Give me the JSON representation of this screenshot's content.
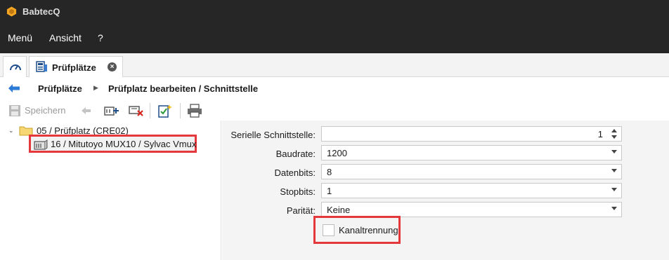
{
  "window": {
    "title": "BabtecQ",
    "logo_icon": "hexagon-logo-icon",
    "logo_color": "#f5a623"
  },
  "menu": {
    "items": [
      "Menü",
      "Ansicht",
      "?"
    ]
  },
  "tabs": {
    "home_icon": "gauge-icon",
    "active": {
      "label": "Prüfplätze",
      "icon": "workstation-icon",
      "close_icon": "close-circle-icon"
    }
  },
  "breadcrumb": {
    "back_icon": "arrow-left-icon",
    "items": [
      "Prüfplätze",
      "Prüfplatz bearbeiten / Schnittstelle"
    ],
    "separator_icon": "caret-right-icon"
  },
  "toolbar": {
    "save_label": "Speichern",
    "buttons": [
      "save-icon",
      "undo-icon",
      "add-interface-icon",
      "delete-interface-icon",
      "new-document-icon",
      "print-icon"
    ]
  },
  "tree": {
    "root": {
      "label": "05 / Prüfplatz (CRE02)",
      "expanded": true,
      "icon": "folder-icon"
    },
    "child": {
      "label": "16 / Mitutoyo MUX10 / Sylvac Vmux",
      "icon": "device-icon",
      "highlight_color": "#e4383c"
    }
  },
  "form": {
    "serial": {
      "label": "Serielle Schnittstelle:",
      "value": "1"
    },
    "baudrate": {
      "label": "Baudrate:",
      "value": "1200"
    },
    "databits": {
      "label": "Datenbits:",
      "value": "8"
    },
    "stopbits": {
      "label": "Stopbits:",
      "value": "1"
    },
    "parity": {
      "label": "Parität:",
      "value": "Keine"
    },
    "channel_separation": {
      "label": "Kanaltrennung",
      "checked": false
    }
  }
}
